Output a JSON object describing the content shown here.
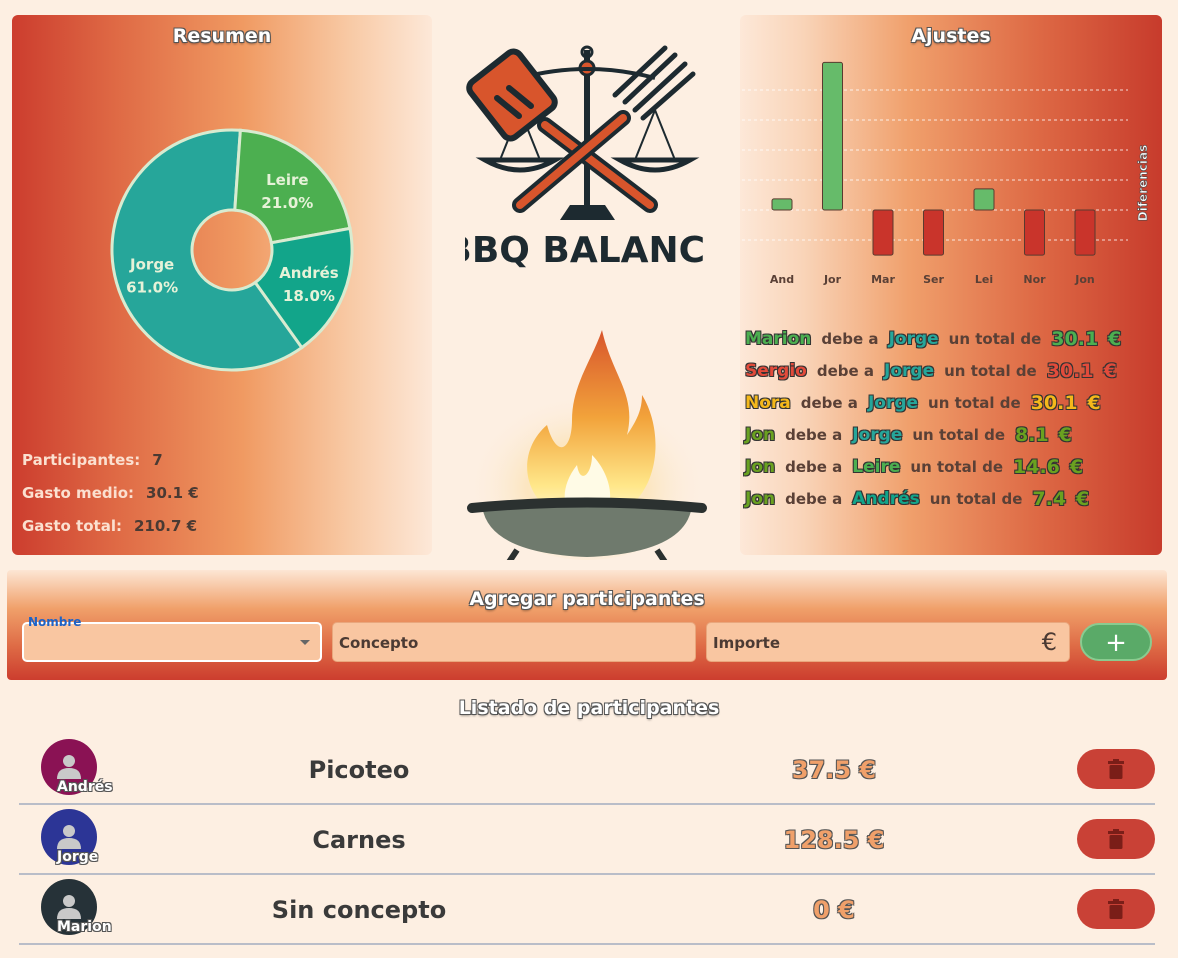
{
  "summary": {
    "title": "Resumen",
    "stats": [
      {
        "label": "Participantes:",
        "value": "7"
      },
      {
        "label": "Gasto medio:",
        "value": "30.1 €"
      },
      {
        "label": "Gasto total:",
        "value": "210.7 €"
      }
    ]
  },
  "chart_data": [
    {
      "type": "pie",
      "title": "",
      "categories": [
        "Jorge",
        "Leire",
        "Andrés"
      ],
      "values": [
        61.0,
        21.0,
        18.0
      ],
      "labels": [
        "61.0%",
        "21.0%",
        "18.0%"
      ],
      "colors": [
        "#26a69a",
        "#4caf50",
        "#12a58a"
      ],
      "legend": "none"
    },
    {
      "type": "bar",
      "title": "",
      "categories": [
        "And",
        "Jor",
        "Mar",
        "Ser",
        "Lei",
        "Nor",
        "Jon"
      ],
      "values": [
        7.4,
        98.4,
        -30.1,
        -30.1,
        14.1,
        -30.1,
        -30.1
      ],
      "ylabel": "Diferencias",
      "ylim": [
        -40,
        100
      ],
      "grid": true,
      "colors": {
        "positive": "#66bb6a",
        "negative": "#c9342b"
      }
    }
  ],
  "settlements": {
    "title": "Ajustes",
    "debe_a": "debe a",
    "un_total_de": "un total de",
    "currency": "€",
    "rows": [
      {
        "from": "Marion",
        "from_color": "#4caf50",
        "to": "Jorge",
        "to_color": "#26a69a",
        "amount": "30.1",
        "amount_color": "#4caf50"
      },
      {
        "from": "Sergio",
        "from_color": "#e24b3b",
        "to": "Jorge",
        "to_color": "#26a69a",
        "amount": "30.1",
        "amount_color": "#e24b3b"
      },
      {
        "from": "Nora",
        "from_color": "#f5b81b",
        "to": "Jorge",
        "to_color": "#26a69a",
        "amount": "30.1",
        "amount_color": "#f5b81b"
      },
      {
        "from": "Jon",
        "from_color": "#6aa120",
        "to": "Jorge",
        "to_color": "#26a69a",
        "amount": "8.1",
        "amount_color": "#6aa120"
      },
      {
        "from": "Jon",
        "from_color": "#6aa120",
        "to": "Leire",
        "to_color": "#4caf50",
        "amount": "14.6",
        "amount_color": "#6aa120"
      },
      {
        "from": "Jon",
        "from_color": "#6aa120",
        "to": "Andrés",
        "to_color": "#12a58a",
        "amount": "7.4",
        "amount_color": "#6aa120"
      }
    ]
  },
  "logo": {
    "text": "BBQ BALANCE"
  },
  "add": {
    "title": "Agregar participantes",
    "nombre_label": "Nombre",
    "concepto_placeholder": "Concepto",
    "importe_placeholder": "Importe",
    "currency_symbol": "€",
    "add_label": "+"
  },
  "list": {
    "title": "Listado de participantes",
    "rows": [
      {
        "name": "Andrés",
        "avatar_color": "#8a1254",
        "concept": "Picoteo",
        "amount": "37.5 €"
      },
      {
        "name": "Jorge",
        "avatar_color": "#2c3596",
        "concept": "Carnes",
        "amount": "128.5 €"
      },
      {
        "name": "Marion",
        "avatar_color": "#263238",
        "concept": "Sin concepto",
        "amount": "0 €"
      }
    ]
  },
  "colors": {
    "accent": "#cc3d2e",
    "success": "#5aaa68",
    "danger": "#c94136"
  }
}
